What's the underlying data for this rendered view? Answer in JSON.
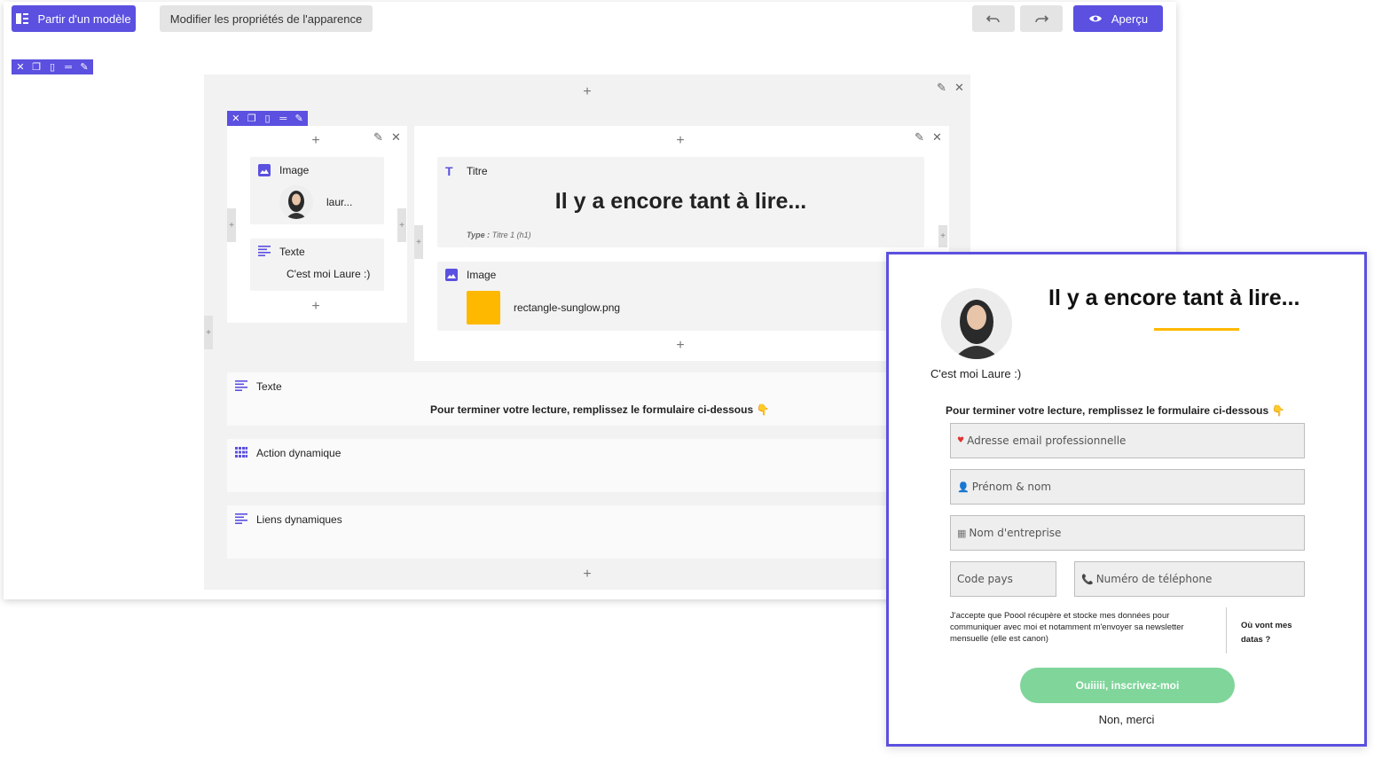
{
  "toolbar": {
    "template_label": "Partir d'un modèle",
    "appearance_label": "Modifier les propriétés de l'apparence",
    "preview_label": "Aperçu"
  },
  "editor": {
    "left_column": {
      "image_block": {
        "label": "Image",
        "value": "laur..."
      },
      "text_block": {
        "label": "Texte",
        "value": "C'est moi Laure :)"
      }
    },
    "right_column": {
      "title_block": {
        "label": "Titre",
        "value": "Il y a encore tant à lire...",
        "type_prefix": "Type :",
        "type_value": "Titre 1 (h1)"
      },
      "image_block": {
        "label": "Image",
        "value": "rectangle-sunglow.png"
      }
    },
    "rows": [
      {
        "label": "Texte",
        "value": "Pour terminer votre lecture, remplissez le formulaire ci-dessous 👇"
      },
      {
        "label": "Action dynamique"
      },
      {
        "label": "Liens dynamiques"
      }
    ]
  },
  "preview": {
    "caption": "C'est moi Laure :)",
    "title": "Il y a encore tant à lire...",
    "instruction": "Pour terminer votre lecture, remplissez le formulaire ci-dessous 👇",
    "fields": {
      "email": "Adresse email professionnelle",
      "name": "Prénom & nom",
      "company": "Nom d'entreprise",
      "country_code": "Code pays",
      "phone": "Numéro de téléphone"
    },
    "consent": "J'accepte que Poool récupère et stocke mes données pour communiquer avec moi et notamment m'envoyer sa newsletter mensuelle (elle est canon)",
    "data_link": "Où vont mes datas ?",
    "submit": "Ouiiiii, inscrivez-moi",
    "decline": "Non, merci"
  },
  "colors": {
    "accent": "#5b50e0",
    "sunglow": "#ffb800",
    "submit_green": "#7fd59a"
  }
}
